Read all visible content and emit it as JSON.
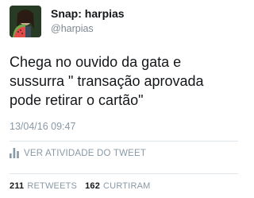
{
  "header": {
    "name": "Snap: harpias",
    "handle": "@harpias"
  },
  "tweet": {
    "lines": [
      "Chega no ouvido da gata e",
      "sussurra \" transação aprovada",
      "pode retirar o cartão\""
    ],
    "timestamp": "13/04/16 09:47"
  },
  "activity": {
    "label": "VER ATIVIDADE DO TWEET"
  },
  "stats": {
    "retweets_count": "211",
    "retweets_label": "RETWEETS",
    "likes_count": "162",
    "likes_label": "CURTIRAM"
  },
  "colors": {
    "muted": "#8899a6",
    "text": "#14171a",
    "divider": "#e1e8ed"
  },
  "icons": {
    "avatar": "profile-photo",
    "activity": "bar-chart-icon"
  }
}
